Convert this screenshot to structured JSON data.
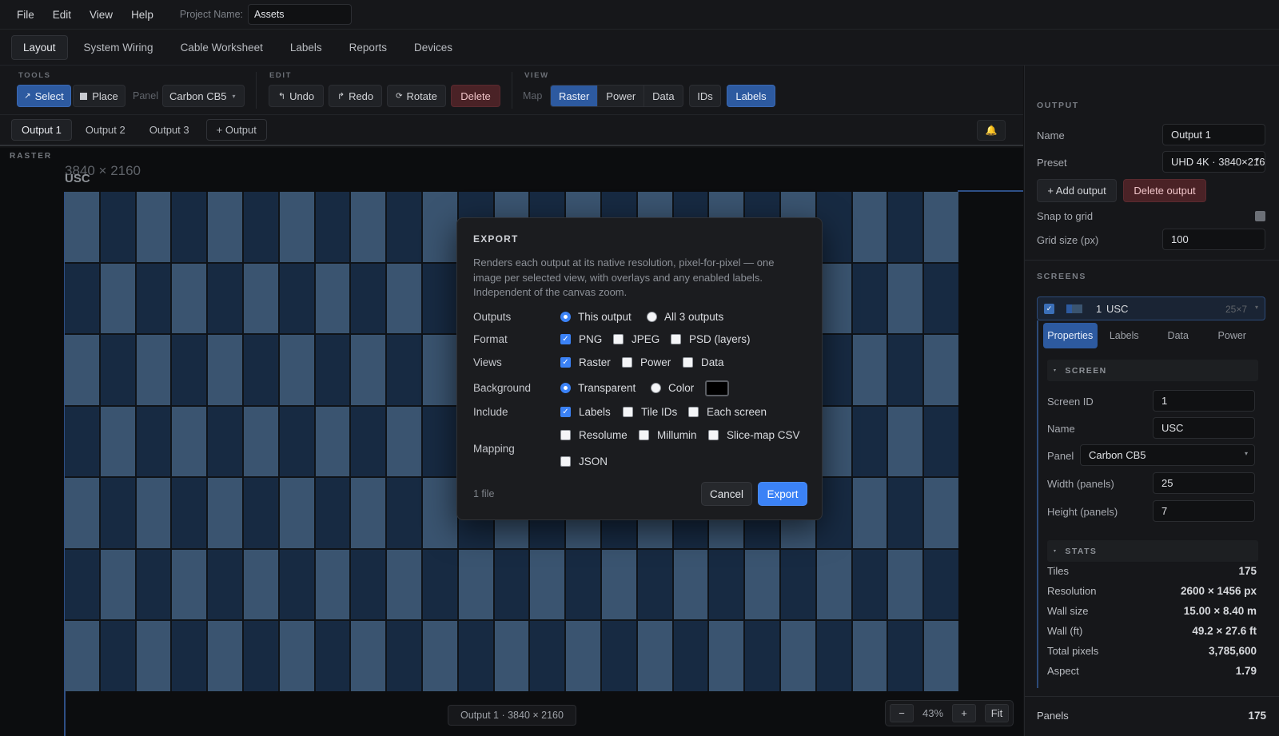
{
  "menu": {
    "items": [
      "File",
      "Edit",
      "View",
      "Help"
    ],
    "project_label": "Project Name:",
    "project_value": "Assets"
  },
  "tabs": [
    "Layout",
    "System Wiring",
    "Cable Worksheet",
    "Labels",
    "Reports",
    "Devices"
  ],
  "toolbar": {
    "tools_label": "TOOLS",
    "select": "Select",
    "place": "Place",
    "panel_label": "Panel",
    "panel_value": "Carbon CB5",
    "edit_label": "EDIT",
    "undo": "Undo",
    "redo": "Redo",
    "rotate": "Rotate",
    "delete": "Delete",
    "view_label": "VIEW",
    "map_label": "Map",
    "views": [
      "Raster",
      "Power",
      "Data"
    ],
    "ids": "IDs",
    "labels": "Labels"
  },
  "outputs": {
    "tabs": [
      "Output 1",
      "Output 2",
      "Output 3"
    ],
    "add": "+ Output"
  },
  "canvas": {
    "label": "RASTER",
    "resolution": "3840 × 2160",
    "screen_name": "USC",
    "footer": "Output 1 · 3840 × 2160",
    "zoom": "43%",
    "zoom_out": "−",
    "zoom_in": "+",
    "fit": "Fit",
    "cols": 25,
    "rows": 7
  },
  "side": {
    "output_title": "OUTPUT",
    "name_label": "Name",
    "name_value": "Output 1",
    "preset_label": "Preset",
    "preset_value": "UHD 4K · 3840×2160",
    "add_output": "+ Add output",
    "delete_output": "Delete output",
    "snap_label": "Snap to grid",
    "grid_label": "Grid size (px)",
    "grid_value": "100",
    "screens_title": "SCREENS",
    "screen_index": "1",
    "screen_name": "USC",
    "screen_dims": "25×7",
    "ptabs": [
      "Properties",
      "Labels",
      "Data",
      "Power"
    ],
    "screen_section": "SCREEN",
    "screen_id_label": "Screen ID",
    "screen_id_value": "1",
    "sname_label": "Name",
    "sname_value": "USC",
    "panel_label": "Panel",
    "panel_value": "Carbon CB5",
    "width_label": "Width (panels)",
    "width_value": "25",
    "height_label": "Height (panels)",
    "height_value": "7",
    "stats_section": "STATS",
    "stats": [
      {
        "label": "Tiles",
        "value": "175"
      },
      {
        "label": "Resolution",
        "value": "2600 × 1456 px"
      },
      {
        "label": "Wall size",
        "value": "15.00 × 8.40 m"
      },
      {
        "label": "Wall (ft)",
        "value": "49.2 × 27.6 ft"
      },
      {
        "label": "Total pixels",
        "value": "3,785,600"
      },
      {
        "label": "Aspect",
        "value": "1.79"
      }
    ],
    "panels_label": "Panels",
    "panels_value": "175"
  },
  "modal": {
    "title": "EXPORT",
    "description": "Renders each output at its native resolution, pixel-for-pixel — one image per selected view, with overlays and any enabled labels. Independent of the canvas zoom.",
    "outputs_label": "Outputs",
    "this_output": "This output",
    "all_outputs": "All 3 outputs",
    "format_label": "Format",
    "png": "PNG",
    "jpeg": "JPEG",
    "psd": "PSD (layers)",
    "views_label": "Views",
    "raster": "Raster",
    "power": "Power",
    "data": "Data",
    "background_label": "Background",
    "transparent": "Transparent",
    "color": "Color",
    "include_label": "Include",
    "labels": "Labels",
    "tile_ids": "Tile IDs",
    "each_screen": "Each screen",
    "mapping_label": "Mapping",
    "resolume": "Resolume",
    "millumin": "Millumin",
    "slice_csv": "Slice-map CSV",
    "json": "JSON",
    "file_count": "1 file",
    "cancel": "Cancel",
    "export": "Export"
  }
}
